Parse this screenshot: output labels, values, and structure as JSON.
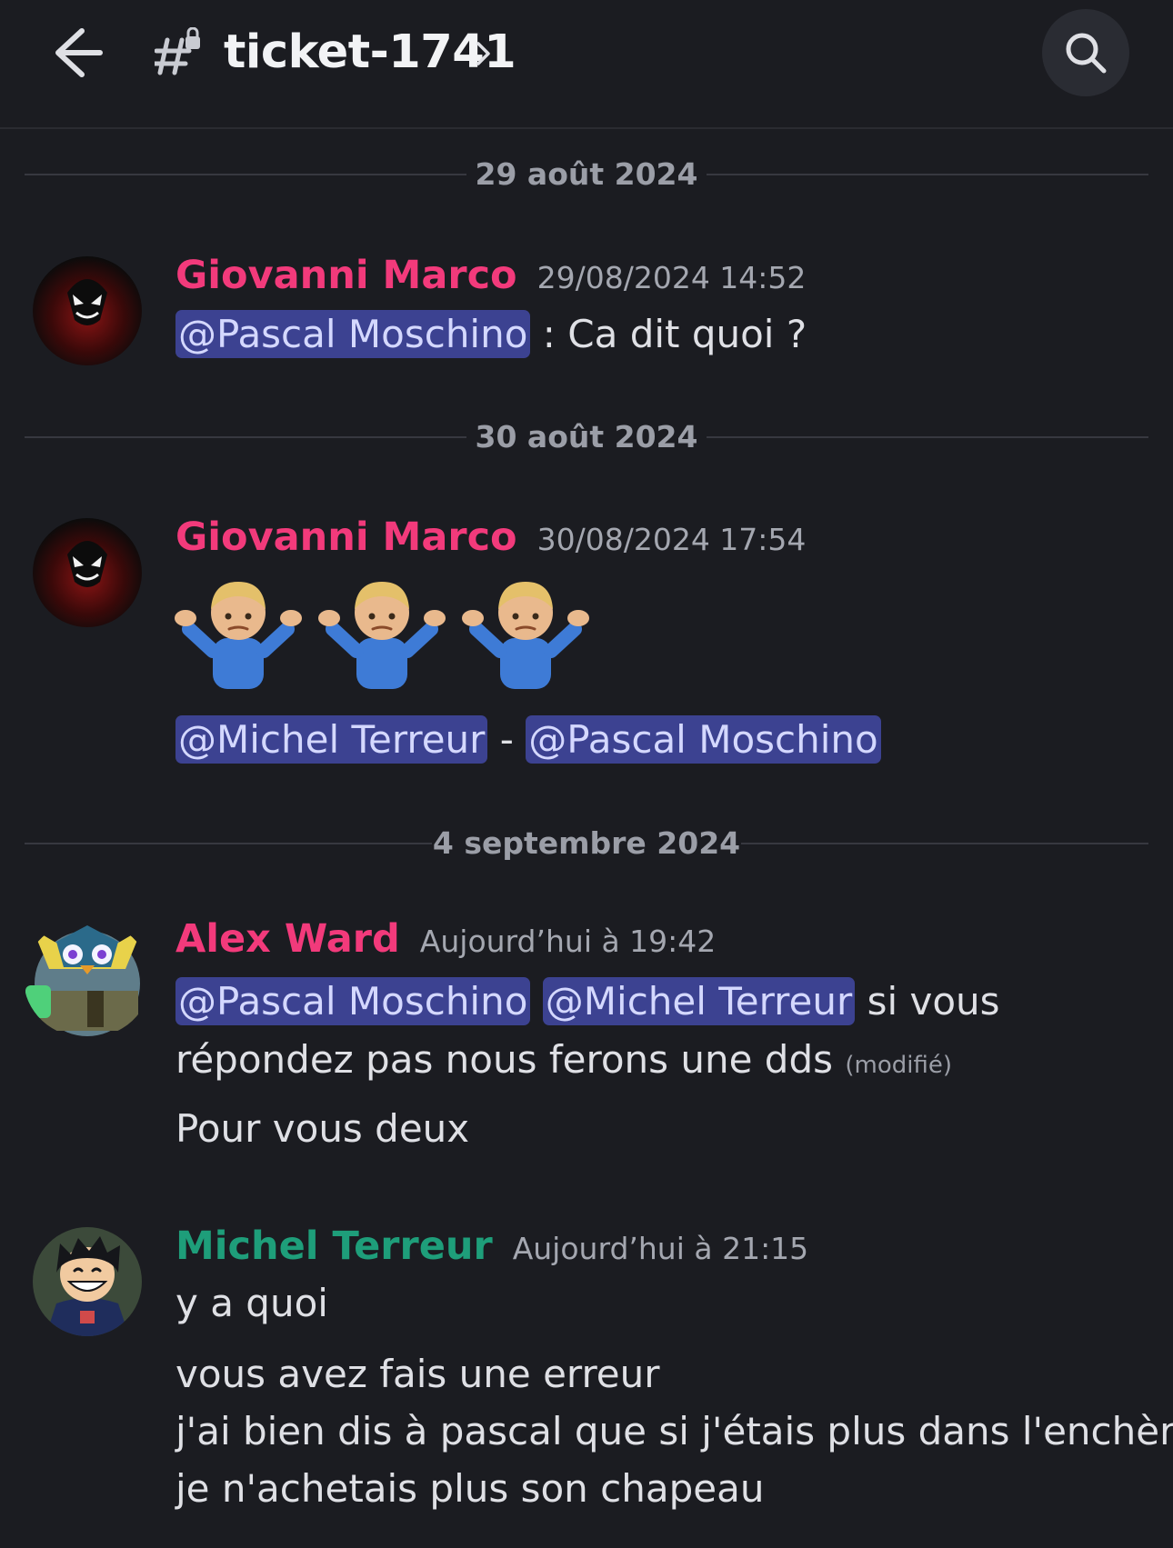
{
  "header": {
    "channel_name": "ticket-1741",
    "back_icon": "arrow-left-icon",
    "channel_icon": "thread-hash-icon",
    "search_icon": "search-icon"
  },
  "colors": {
    "background": "#1b1c21",
    "author_pink": "#f23a7b",
    "author_green": "#1e9e7a",
    "mention_bg": "#3c4291"
  },
  "dividers": [
    "29 août 2024",
    "30 août 2024",
    "4 septembre 2024"
  ],
  "messages": [
    {
      "author": "Giovanni Marco",
      "timestamp": "29/08/2024 14:52",
      "mention_1": "@Pascal Moschino",
      "text_1": " : Ca dit quoi ?"
    },
    {
      "author": "Giovanni Marco",
      "timestamp": "30/08/2024 17:54",
      "emojis": [
        "🤷🏼‍♂️",
        "🤷🏼‍♂️",
        "🤷🏼‍♂️"
      ],
      "mention_1": "@Michel Terreur",
      "separator": " - ",
      "mention_2": "@Pascal Moschino"
    },
    {
      "author": "Alex Ward",
      "timestamp": "Aujourd’hui à 19:42",
      "mention_1": "@Pascal Moschino",
      "mention_2": "@Michel Terreur",
      "text_1": " si vous",
      "text_2": "répondez pas nous ferons une dds",
      "edited": "(modifié)",
      "text_3": "Pour vous deux"
    },
    {
      "author": "Michel Terreur",
      "timestamp": "Aujourd’hui à 21:15",
      "text_1": "y a quoi",
      "text_2": "vous avez fais une erreur",
      "text_3": "j'ai bien dis à pascal que si j'étais plus dans l'enchère",
      "text_4": "je n'achetais plus son chapeau"
    }
  ]
}
